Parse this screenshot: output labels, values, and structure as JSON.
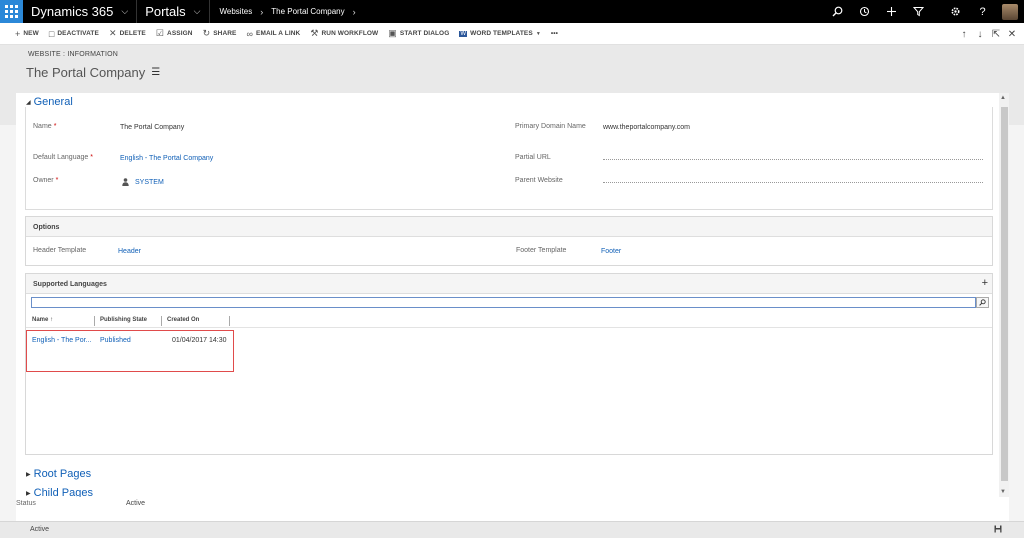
{
  "navbar": {
    "app_name": "Dynamics 365",
    "area": "Portals",
    "crumb_1": "Websites",
    "crumb_2": "The Portal Company"
  },
  "commands": [
    {
      "icon": "+",
      "label": "NEW"
    },
    {
      "icon": "□",
      "label": "DEACTIVATE"
    },
    {
      "icon": "✕",
      "label": "DELETE"
    },
    {
      "icon": "☑",
      "label": "ASSIGN"
    },
    {
      "icon": "↻",
      "label": "SHARE"
    },
    {
      "icon": "∞",
      "label": "EMAIL A LINK"
    },
    {
      "icon": "⚒",
      "label": "RUN WORKFLOW"
    },
    {
      "icon": "▣",
      "label": "START DIALOG"
    },
    {
      "icon": "W",
      "label": "WORD TEMPLATES"
    },
    {
      "icon": "",
      "label": "•••"
    }
  ],
  "header": {
    "record_type": "WEBSITE : INFORMATION",
    "record_title": "The Portal Company"
  },
  "general": {
    "title": "General",
    "name_label": "Name",
    "name_value": "The Portal Company",
    "language_label": "Default Language",
    "language_value": "English - The Portal Company",
    "owner_label": "Owner",
    "owner_value": "SYSTEM",
    "domain_label": "Primary Domain Name",
    "domain_value": "www.theportalcompany.com",
    "partial_url_label": "Partial URL",
    "parent_label": "Parent Website"
  },
  "options": {
    "title": "Options",
    "header_label": "Header Template",
    "header_value": "Header",
    "footer_label": "Footer Template",
    "footer_value": "Footer"
  },
  "languages": {
    "title": "Supported Languages",
    "columns": [
      "Name ↑",
      "Publishing State",
      "Created On"
    ],
    "rows": [
      {
        "name": "English - The Por...",
        "state": "Published",
        "created": "01/04/2017 14:30"
      }
    ]
  },
  "sections": {
    "root_pages": "Root Pages",
    "child_pages": "Child Pages"
  },
  "status": {
    "label": "Status",
    "value": "Active"
  },
  "footer": {
    "status": "Active"
  },
  "colors": {
    "accent": "#1160b7",
    "waffle": "#2b88d8",
    "highlight": "#e04b4b"
  }
}
